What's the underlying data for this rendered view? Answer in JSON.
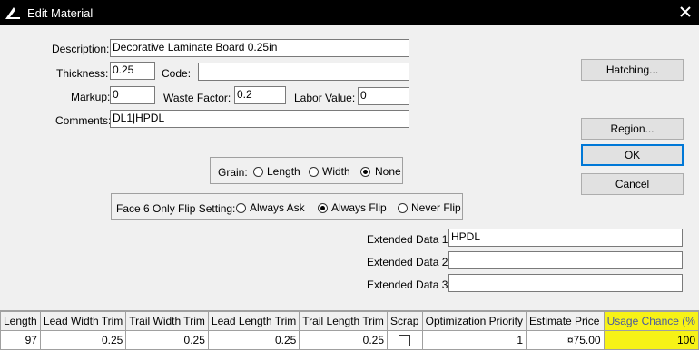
{
  "window": {
    "title": "Edit Material"
  },
  "form": {
    "description": {
      "label": "Description:",
      "value": "Decorative Laminate Board 0.25in"
    },
    "thickness": {
      "label": "Thickness:",
      "value": "0.25"
    },
    "code": {
      "label": "Code:",
      "value": ""
    },
    "markup": {
      "label": "Markup:",
      "value": "0"
    },
    "waste_factor": {
      "label": "Waste Factor:",
      "value": "0.2"
    },
    "labor_value": {
      "label": "Labor Value:",
      "value": "0"
    },
    "comments": {
      "label": "Comments:",
      "value": "DL1|HPDL"
    }
  },
  "grain": {
    "label": "Grain:",
    "options": [
      "Length",
      "Width",
      "None"
    ],
    "selected": "None"
  },
  "face6": {
    "label": "Face 6 Only Flip Setting:",
    "options": [
      "Always Ask",
      "Always Flip",
      "Never Flip"
    ],
    "selected": "Always Flip"
  },
  "extended": [
    {
      "label": "Extended Data 1",
      "value": "HPDL"
    },
    {
      "label": "Extended Data 2",
      "value": ""
    },
    {
      "label": "Extended Data 3",
      "value": ""
    }
  ],
  "buttons": {
    "hatching": "Hatching...",
    "region": "Region...",
    "ok": "OK",
    "cancel": "Cancel"
  },
  "grid": {
    "columns": [
      "Length",
      "Lead Width Trim",
      "Trail Width Trim",
      "Lead Length Trim",
      "Trail Length Trim",
      "Scrap",
      "Optimization Priority",
      "Estimate Price",
      "Usage Chance (%"
    ],
    "row": [
      "97",
      "0.25",
      "0.25",
      "0.25",
      "0.25",
      "",
      "1",
      "¤75.00",
      "100"
    ],
    "highlight_color": "#f7f216"
  }
}
